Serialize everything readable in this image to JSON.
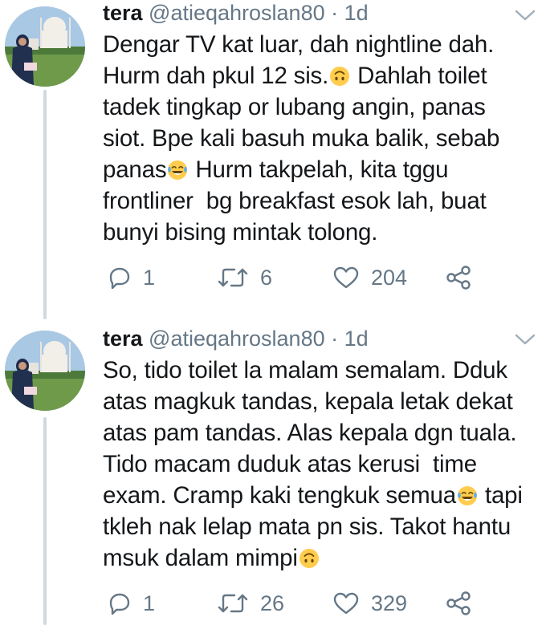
{
  "tweets": [
    {
      "name": "tera",
      "handle": "@atieqahroslan80",
      "separator": "·",
      "time": "1d",
      "text_lines": [
        [
          "Dengar TV kat luar, dah nightline dah."
        ],
        [
          "Hurm dah pkul 12 sis.",
          "upside-down-face-emoji",
          " Dahlah toilet"
        ],
        [
          "tadek tingkap or lubang angin, panas"
        ],
        [
          "siot. Bpe kali basuh muka balik, sebab"
        ],
        [
          "panas",
          "tears-of-joy-emoji",
          " Hurm takpelah, kita tggu"
        ],
        [
          "frontliner  bg breakfast esok lah, buat"
        ],
        [
          "bunyi bising mintak tolong."
        ]
      ],
      "replies": "1",
      "retweets": "6",
      "likes": "204"
    },
    {
      "name": "tera",
      "handle": "@atieqahroslan80",
      "separator": "·",
      "time": "1d",
      "text_lines": [
        [
          "So, tido toilet la malam semalam. Dduk"
        ],
        [
          "atas magkuk tandas, kepala letak dekat"
        ],
        [
          "atas pam tandas. Alas kepala dgn tuala."
        ],
        [
          "Tido macam duduk atas kerusi  time"
        ],
        [
          "exam. Cramp kaki tengkuk semua",
          "tears-of-joy-emoji",
          " tapi"
        ],
        [
          "tkleh nak lelap mata pn sis. Takot hantu"
        ],
        [
          "msuk dalam mimpi",
          "upside-down-face-emoji"
        ]
      ],
      "replies": "1",
      "retweets": "26",
      "likes": "329"
    }
  ],
  "icons": {
    "reply": "reply-icon",
    "retweet": "retweet-icon",
    "like": "heart-icon",
    "share": "share-icon",
    "more": "chevron-down-icon"
  },
  "colors": {
    "text": "#14171a",
    "secondary": "#657786",
    "thread_line": "#cfd9de",
    "emoji_yellow": "#ffcc4d",
    "tears_blue": "#5dadec"
  }
}
